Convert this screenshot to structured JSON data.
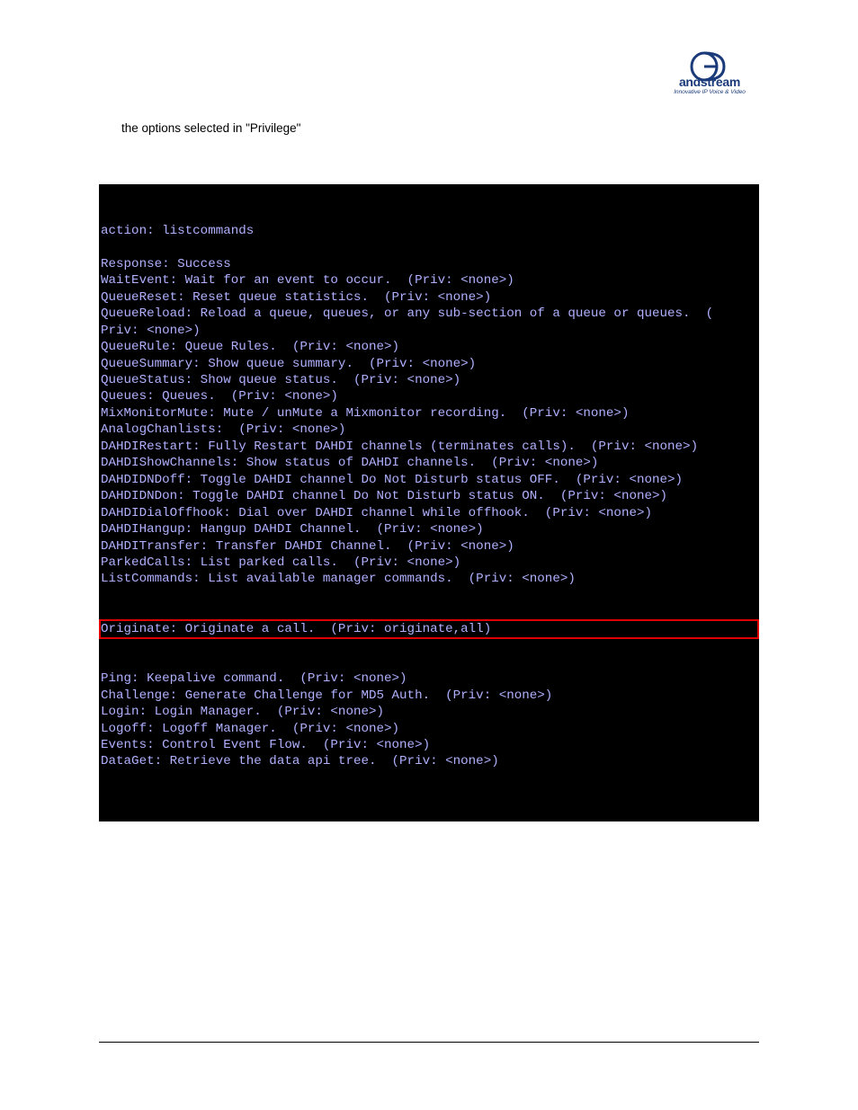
{
  "logo": {
    "brand_prefix": "G",
    "brand_rest": "andstream",
    "tagline": "Innovative IP Voice & Video"
  },
  "intro": "the options selected in \"Privilege\"",
  "terminal": {
    "lines": [
      "action: listcommands",
      "",
      "Response: Success",
      "WaitEvent: Wait for an event to occur.  (Priv: <none>)",
      "QueueReset: Reset queue statistics.  (Priv: <none>)",
      "QueueReload: Reload a queue, queues, or any sub-section of a queue or queues.  (",
      "Priv: <none>)",
      "QueueRule: Queue Rules.  (Priv: <none>)",
      "QueueSummary: Show queue summary.  (Priv: <none>)",
      "QueueStatus: Show queue status.  (Priv: <none>)",
      "Queues: Queues.  (Priv: <none>)",
      "MixMonitorMute: Mute / unMute a Mixmonitor recording.  (Priv: <none>)",
      "AnalogChanlists:  (Priv: <none>)",
      "DAHDIRestart: Fully Restart DAHDI channels (terminates calls).  (Priv: <none>)",
      "DAHDIShowChannels: Show status of DAHDI channels.  (Priv: <none>)",
      "DAHDIDNDoff: Toggle DAHDI channel Do Not Disturb status OFF.  (Priv: <none>)",
      "DAHDIDNDon: Toggle DAHDI channel Do Not Disturb status ON.  (Priv: <none>)",
      "DAHDIDialOffhook: Dial over DAHDI channel while offhook.  (Priv: <none>)",
      "DAHDIHangup: Hangup DAHDI Channel.  (Priv: <none>)",
      "DAHDITransfer: Transfer DAHDI Channel.  (Priv: <none>)",
      "ParkedCalls: List parked calls.  (Priv: <none>)",
      "ListCommands: List available manager commands.  (Priv: <none>)"
    ],
    "highlighted": "Originate: Originate a call.  (Priv: originate,all)",
    "lines_after": [
      "Ping: Keepalive command.  (Priv: <none>)",
      "Challenge: Generate Challenge for MD5 Auth.  (Priv: <none>)",
      "Login: Login Manager.  (Priv: <none>)",
      "Logoff: Logoff Manager.  (Priv: <none>)",
      "Events: Control Event Flow.  (Priv: <none>)",
      "DataGet: Retrieve the data api tree.  (Priv: <none>)"
    ]
  }
}
